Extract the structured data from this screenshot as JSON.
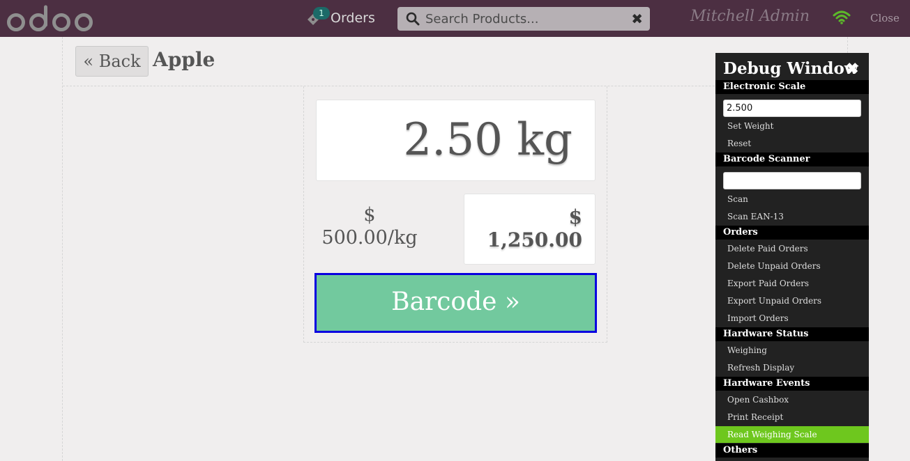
{
  "topbar": {
    "logo_text": "odoo",
    "orders": {
      "count": "1",
      "label": "Orders"
    },
    "search": {
      "placeholder": "Search Products..."
    },
    "user_name": "Mitchell Admin",
    "close_label": "Close"
  },
  "screen": {
    "back_label": "« Back",
    "product_name": "Apple",
    "weight": "2.50 kg",
    "unit_price": "$ 500.00/kg",
    "total": "$ 1,250.00",
    "barcode_label": "Barcode »"
  },
  "debug": {
    "title": "Debug Window",
    "close_icon": "✖",
    "electronic_scale": {
      "header": "Electronic Scale",
      "weight_value": "2.500",
      "set_weight": "Set Weight",
      "reset": "Reset"
    },
    "barcode_scanner": {
      "header": "Barcode Scanner",
      "input_value": "",
      "scan": "Scan",
      "scan_ean13": "Scan EAN-13"
    },
    "orders": {
      "header": "Orders",
      "delete_paid": "Delete Paid Orders",
      "delete_unpaid": "Delete Unpaid Orders",
      "export_paid": "Export Paid Orders",
      "export_unpaid": "Export Unpaid Orders",
      "import": "Import Orders"
    },
    "hardware_status": {
      "header": "Hardware Status",
      "weighing": "Weighing",
      "refresh": "Refresh Display"
    },
    "hardware_events": {
      "header": "Hardware Events",
      "open_cashbox": "Open Cashbox",
      "print_receipt": "Print Receipt",
      "read_scale": "Read Weighing Scale"
    },
    "others": {
      "header": "Others"
    }
  },
  "colors": {
    "topbar_bg": "#4c2f42",
    "barcode_button": "#72c99e",
    "barcode_border": "#0a00e0",
    "active_debug_item": "#6ec71e",
    "wifi": "#5cb82a"
  }
}
